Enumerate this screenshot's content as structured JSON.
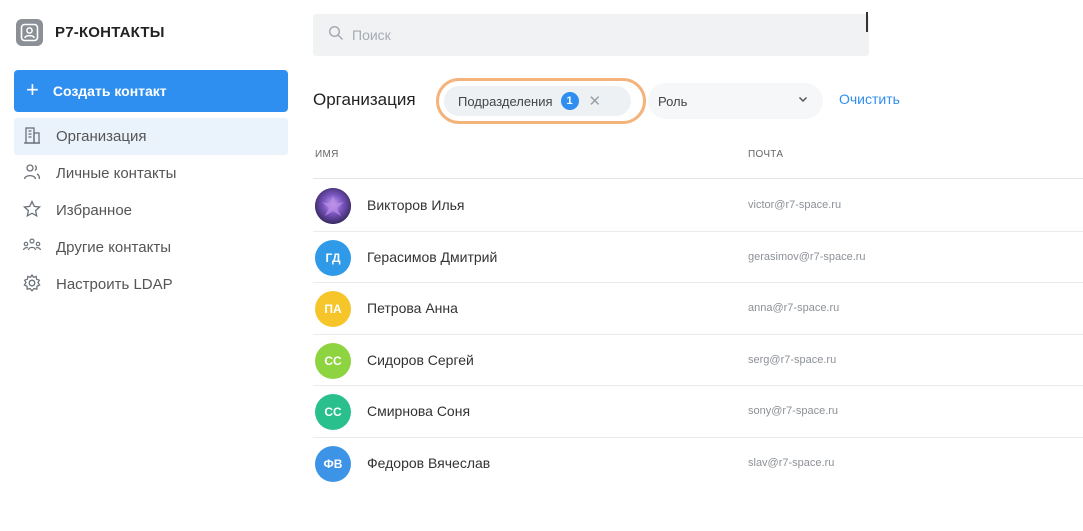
{
  "app": {
    "title": "Р7-КОНТАКТЫ"
  },
  "sidebar": {
    "create_label": "Создать контакт",
    "items": [
      {
        "label": "Организация",
        "icon": "building-icon",
        "active": true
      },
      {
        "label": "Личные контакты",
        "icon": "people-icon",
        "active": false
      },
      {
        "label": "Избранное",
        "icon": "star-icon",
        "active": false
      },
      {
        "label": "Другие контакты",
        "icon": "group-icon",
        "active": false
      },
      {
        "label": "Настроить LDAP",
        "icon": "gear-icon",
        "active": false
      }
    ]
  },
  "search": {
    "placeholder": "Поиск"
  },
  "filters": {
    "section_title": "Организация",
    "chip_label": "Подразделения",
    "chip_count": "1",
    "role_label": "Роль",
    "clear_label": "Очистить"
  },
  "table": {
    "columns": {
      "name": "ИМЯ",
      "email": "ПОЧТА"
    },
    "rows": [
      {
        "initials": "",
        "name": "Викторов Илья",
        "email": "victor@r7-space.ru",
        "avatar_color": "#5b3f8f",
        "photo": true
      },
      {
        "initials": "ГД",
        "name": "Герасимов Дмитрий",
        "email": "gerasimov@r7-space.ru",
        "avatar_color": "#2f9be8",
        "photo": false
      },
      {
        "initials": "ПА",
        "name": "Петрова Анна",
        "email": "anna@r7-space.ru",
        "avatar_color": "#f5c52a",
        "photo": false
      },
      {
        "initials": "СС",
        "name": "Сидоров Сергей",
        "email": "serg@r7-space.ru",
        "avatar_color": "#8ed340",
        "photo": false
      },
      {
        "initials": "СС",
        "name": "Смирнова Соня",
        "email": "sony@r7-space.ru",
        "avatar_color": "#29c08d",
        "photo": false
      },
      {
        "initials": "ФВ",
        "name": "Федоров Вячеслав",
        "email": "slav@r7-space.ru",
        "avatar_color": "#3d93e6",
        "photo": false
      }
    ]
  },
  "colors": {
    "accent": "#2f8ff0",
    "highlight": "#f4b37a"
  }
}
